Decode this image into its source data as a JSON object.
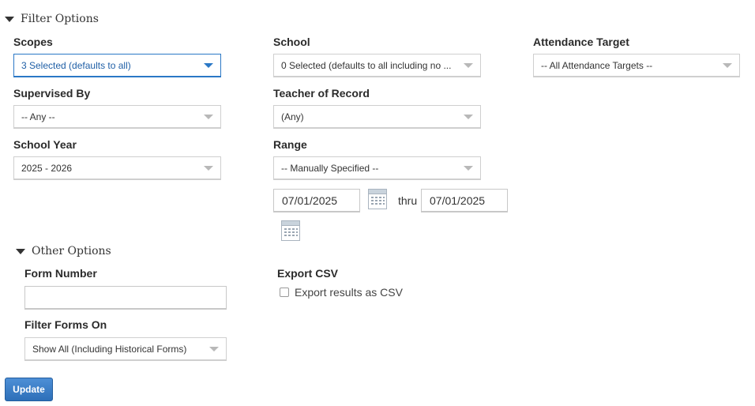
{
  "filter_options": {
    "title": "Filter Options",
    "scopes": {
      "label": "Scopes",
      "value": "3 Selected (defaults to all)"
    },
    "school": {
      "label": "School",
      "value": "0 Selected (defaults to all including no ..."
    },
    "attendance_target": {
      "label": "Attendance Target",
      "value": "-- All Attendance Targets --"
    },
    "supervised_by": {
      "label": "Supervised By",
      "value": "-- Any --"
    },
    "teacher_of_record": {
      "label": "Teacher of Record",
      "value": "(Any)"
    },
    "school_year": {
      "label": "School Year",
      "value": "2025 - 2026"
    },
    "range": {
      "label": "Range",
      "value": "-- Manually Specified --",
      "start_date": "07/01/2025",
      "thru_label": "thru",
      "end_date": "07/01/2025"
    }
  },
  "other_options": {
    "title": "Other Options",
    "form_number": {
      "label": "Form Number",
      "value": ""
    },
    "export_csv": {
      "label": "Export CSV",
      "checkbox_label": "Export results as CSV",
      "checked": false
    },
    "filter_forms_on": {
      "label": "Filter Forms On",
      "value": "Show All (Including Historical Forms)"
    }
  },
  "update_button": {
    "label": "Update"
  },
  "colors": {
    "accent": "#2b78c6",
    "button": "#3a7cc6"
  }
}
